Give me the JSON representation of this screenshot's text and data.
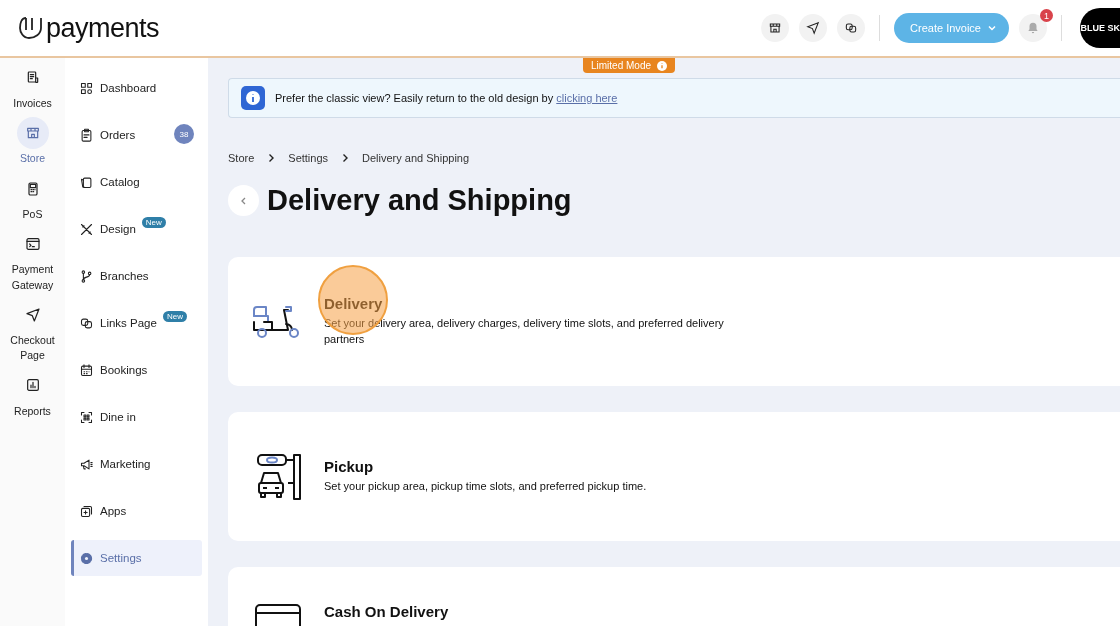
{
  "header": {
    "logo": "payments",
    "create_button": "Create Invoice",
    "notification_count": "1",
    "avatar_text": "BLUE SK"
  },
  "limited_mode": "Limited Mode",
  "rail": [
    {
      "label": "Invoices",
      "selected": false
    },
    {
      "label": "Store",
      "selected": true
    },
    {
      "label": "PoS",
      "selected": false
    },
    {
      "label": "Payment Gateway",
      "selected": false
    },
    {
      "label": "Checkout Page",
      "selected": false
    },
    {
      "label": "Reports",
      "selected": false
    }
  ],
  "sidebar": {
    "items": [
      {
        "label": "Dashboard",
        "selected": false
      },
      {
        "label": "Orders",
        "selected": false,
        "count": "38"
      },
      {
        "label": "Catalog",
        "selected": false
      },
      {
        "label": "Design",
        "selected": false,
        "tag": "New"
      },
      {
        "label": "Branches",
        "selected": false
      },
      {
        "label": "Links Page",
        "selected": false,
        "tag": "New"
      },
      {
        "label": "Bookings",
        "selected": false
      },
      {
        "label": "Dine in",
        "selected": false
      },
      {
        "label": "Marketing",
        "selected": false
      },
      {
        "label": "Apps",
        "selected": false
      },
      {
        "label": "Settings",
        "selected": true
      }
    ]
  },
  "banner": {
    "text": "Prefer the classic view? Easily return to the old design by",
    "link": "clicking here"
  },
  "breadcrumb": [
    "Store",
    "Settings",
    "Delivery and Shipping"
  ],
  "page_title": "Delivery and Shipping",
  "options": [
    {
      "title": "Delivery",
      "description": "Set your delivery area, delivery charges, delivery time slots, and preferred delivery partners"
    },
    {
      "title": "Pickup",
      "description": "Set your pickup area, pickup time slots, and preferred pickup time."
    },
    {
      "title": "Cash On Delivery"
    }
  ]
}
